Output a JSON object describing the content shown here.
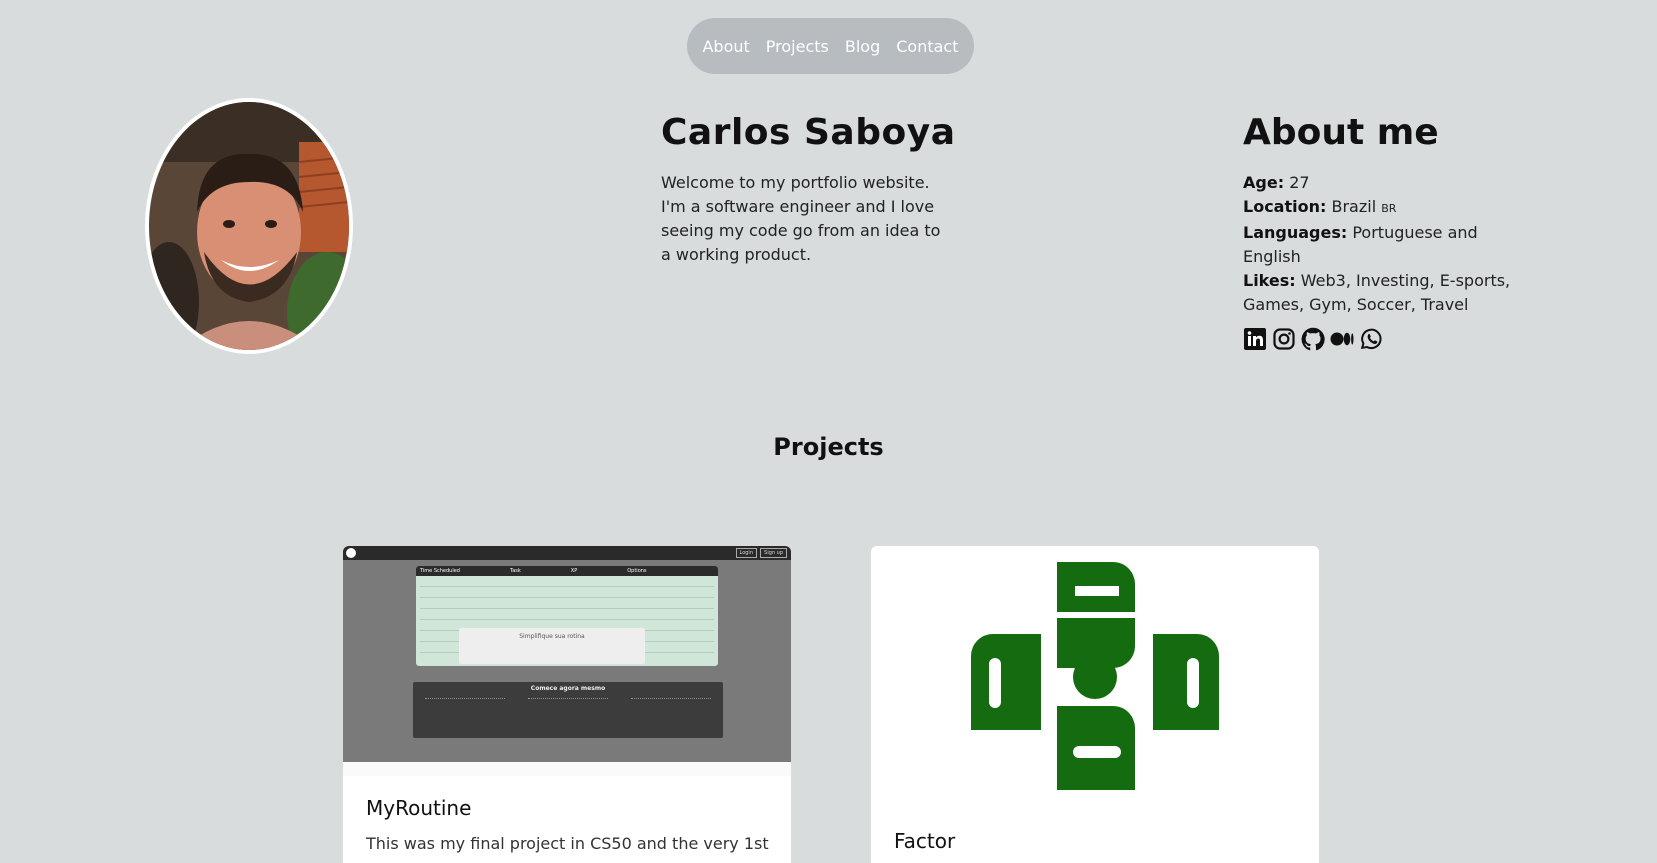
{
  "nav": {
    "items": [
      "About",
      "Projects",
      "Blog",
      "Contact"
    ]
  },
  "intro": {
    "name": "Carlos Saboya",
    "bio": "Welcome to my portfolio website. I'm a software engineer and I love seeing my code go from an idea to a working product."
  },
  "about": {
    "title": "About me",
    "age_label": "Age:",
    "age": "27",
    "location_label": "Location:",
    "location": "Brazil",
    "location_flag": "BR",
    "languages_label": "Languages:",
    "languages": "Portuguese and English",
    "likes_label": "Likes:",
    "likes": "Web3, Investing, E-sports, Games, Gym, Soccer, Travel",
    "socials": [
      "linkedin-icon",
      "instagram-icon",
      "github-icon",
      "medium-icon",
      "whatsapp-icon"
    ]
  },
  "projects": {
    "title": "Projects",
    "items": [
      {
        "name": "MyRoutine",
        "desc": "This was my final project in CS50 and the very 1st",
        "shot": {
          "login": "Login",
          "signup": "Sign up",
          "table_headers": [
            "Time Scheduled",
            "Task",
            "XP",
            "Options"
          ],
          "modal_title": "Simplifique sua rotina",
          "cta_title": "Comece agora mesmo"
        }
      },
      {
        "name": "Factor"
      }
    ]
  },
  "colors": {
    "background": "#d8dcdd",
    "nav_bg": "#b7bcc1",
    "factor_green": "#156b0f"
  }
}
